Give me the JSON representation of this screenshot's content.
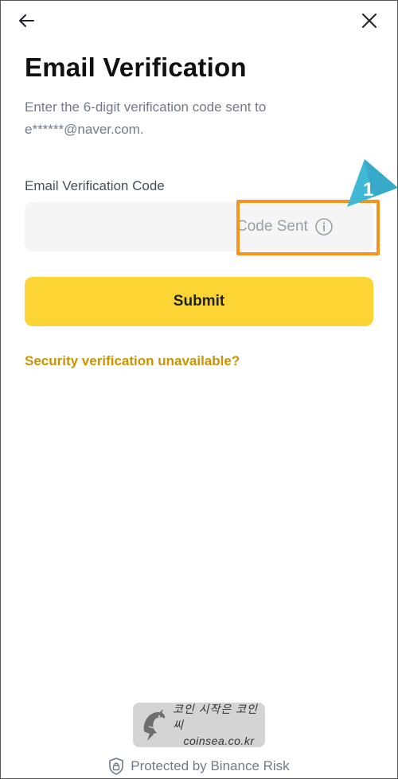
{
  "header": {
    "back_icon": "arrow-left-icon",
    "close_icon": "close-icon"
  },
  "main": {
    "title": "Email Verification",
    "subtitle": "Enter the 6-digit verification code sent to e******@naver.com.",
    "field": {
      "label": "Email Verification Code",
      "value": "",
      "status_text": "Code Sent",
      "status_icon": "info-icon"
    },
    "submit_label": "Submit",
    "security_link": "Security verification unavailable?"
  },
  "annotation": {
    "step_number": "1",
    "highlight_color": "#f7931a",
    "callout_color": "#3fb8d4"
  },
  "watermark": {
    "line1": "코인 시작은 코인씨",
    "line2": "coinsea.co.kr",
    "logo_icon": "dolphin-logo-icon"
  },
  "footer": {
    "text": "Protected by Binance Risk",
    "icon": "shield-lock-icon"
  },
  "colors": {
    "accent": "#fcd535",
    "link": "#c99400",
    "muted_text": "#707a8a"
  }
}
